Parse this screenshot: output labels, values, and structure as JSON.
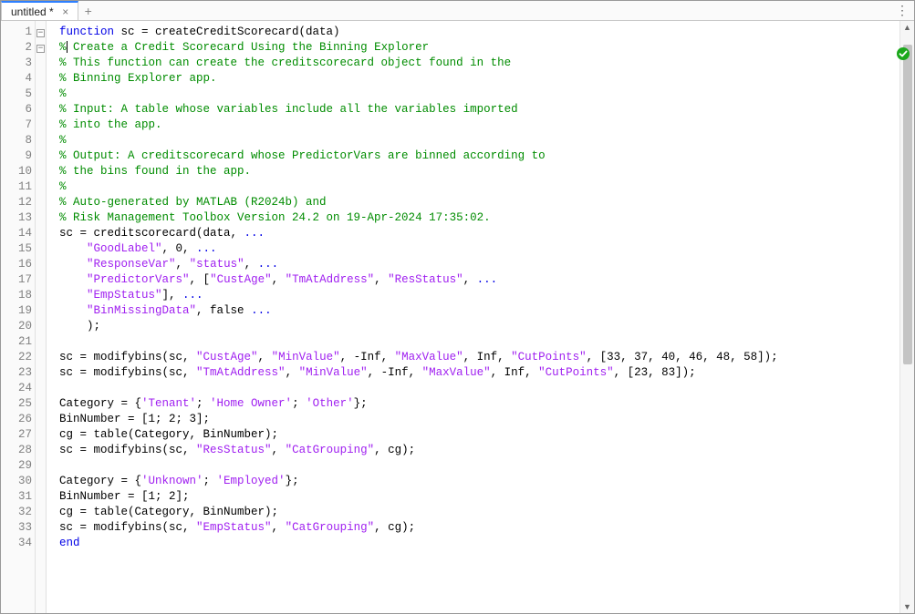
{
  "tab": {
    "title": "untitled *",
    "modified": true
  },
  "status": {
    "state": "ok"
  },
  "code": {
    "lines": [
      {
        "n": 1,
        "fold": "open",
        "tokens": [
          [
            "kw",
            "function"
          ],
          [
            "",
            " sc = createCreditScorecard(data)"
          ]
        ]
      },
      {
        "n": 2,
        "fold": "open",
        "caret": true,
        "tokens": [
          [
            "com",
            "%"
          ],
          [
            "cursor",
            ""
          ],
          [
            "com",
            " Create a Credit Scorecard Using the Binning Explorer"
          ]
        ]
      },
      {
        "n": 3,
        "tokens": [
          [
            "com",
            "% This function can create the creditscorecard object found in the"
          ]
        ]
      },
      {
        "n": 4,
        "tokens": [
          [
            "com",
            "% Binning Explorer app."
          ]
        ]
      },
      {
        "n": 5,
        "tokens": [
          [
            "com",
            "%"
          ]
        ]
      },
      {
        "n": 6,
        "tokens": [
          [
            "com",
            "% Input: A table whose variables include all the variables imported"
          ]
        ]
      },
      {
        "n": 7,
        "tokens": [
          [
            "com",
            "% into the app."
          ]
        ]
      },
      {
        "n": 8,
        "tokens": [
          [
            "com",
            "%"
          ]
        ]
      },
      {
        "n": 9,
        "tokens": [
          [
            "com",
            "% Output: A creditscorecard whose PredictorVars are binned according to"
          ]
        ]
      },
      {
        "n": 10,
        "tokens": [
          [
            "com",
            "% the bins found in the app."
          ]
        ]
      },
      {
        "n": 11,
        "tokens": [
          [
            "com",
            "%"
          ]
        ]
      },
      {
        "n": 12,
        "tokens": [
          [
            "com",
            "% Auto-generated by MATLAB (R2024b) and"
          ]
        ]
      },
      {
        "n": 13,
        "tokens": [
          [
            "com",
            "% Risk Management Toolbox Version 24.2 on 19-Apr-2024 17:35:02."
          ]
        ]
      },
      {
        "n": 14,
        "tokens": [
          [
            "",
            "sc = creditscorecard(data, "
          ],
          [
            "kw",
            "..."
          ]
        ]
      },
      {
        "n": 15,
        "tokens": [
          [
            "",
            "    "
          ],
          [
            "str",
            "\"GoodLabel\""
          ],
          [
            "",
            ", 0, "
          ],
          [
            "kw",
            "..."
          ]
        ]
      },
      {
        "n": 16,
        "tokens": [
          [
            "",
            "    "
          ],
          [
            "str",
            "\"ResponseVar\""
          ],
          [
            "",
            ", "
          ],
          [
            "str",
            "\"status\""
          ],
          [
            "",
            ", "
          ],
          [
            "kw",
            "..."
          ]
        ]
      },
      {
        "n": 17,
        "tokens": [
          [
            "",
            "    "
          ],
          [
            "str",
            "\"PredictorVars\""
          ],
          [
            "",
            ", ["
          ],
          [
            "str",
            "\"CustAge\""
          ],
          [
            "",
            ", "
          ],
          [
            "str",
            "\"TmAtAddress\""
          ],
          [
            "",
            ", "
          ],
          [
            "str",
            "\"ResStatus\""
          ],
          [
            "",
            ", "
          ],
          [
            "kw",
            "..."
          ]
        ]
      },
      {
        "n": 18,
        "tokens": [
          [
            "",
            "    "
          ],
          [
            "str",
            "\"EmpStatus\""
          ],
          [
            "",
            "], "
          ],
          [
            "kw",
            "..."
          ]
        ]
      },
      {
        "n": 19,
        "tokens": [
          [
            "",
            "    "
          ],
          [
            "str",
            "\"BinMissingData\""
          ],
          [
            "",
            ", false "
          ],
          [
            "kw",
            "..."
          ]
        ]
      },
      {
        "n": 20,
        "tokens": [
          [
            "",
            "    );"
          ]
        ]
      },
      {
        "n": 21,
        "tokens": [
          [
            "",
            ""
          ]
        ]
      },
      {
        "n": 22,
        "tokens": [
          [
            "",
            "sc = modifybins(sc, "
          ],
          [
            "str",
            "\"CustAge\""
          ],
          [
            "",
            ", "
          ],
          [
            "str",
            "\"MinValue\""
          ],
          [
            "",
            ", -Inf, "
          ],
          [
            "str",
            "\"MaxValue\""
          ],
          [
            "",
            ", Inf, "
          ],
          [
            "str",
            "\"CutPoints\""
          ],
          [
            "",
            ", [33, 37, 40, 46, 48, 58]);"
          ]
        ]
      },
      {
        "n": 23,
        "tokens": [
          [
            "",
            "sc = modifybins(sc, "
          ],
          [
            "str",
            "\"TmAtAddress\""
          ],
          [
            "",
            ", "
          ],
          [
            "str",
            "\"MinValue\""
          ],
          [
            "",
            ", -Inf, "
          ],
          [
            "str",
            "\"MaxValue\""
          ],
          [
            "",
            ", Inf, "
          ],
          [
            "str",
            "\"CutPoints\""
          ],
          [
            "",
            ", [23, 83]);"
          ]
        ]
      },
      {
        "n": 24,
        "tokens": [
          [
            "",
            ""
          ]
        ]
      },
      {
        "n": 25,
        "tokens": [
          [
            "",
            "Category = {"
          ],
          [
            "str",
            "'Tenant'"
          ],
          [
            "",
            "; "
          ],
          [
            "str",
            "'Home Owner'"
          ],
          [
            "",
            "; "
          ],
          [
            "str",
            "'Other'"
          ],
          [
            "",
            "};"
          ]
        ]
      },
      {
        "n": 26,
        "tokens": [
          [
            "",
            "BinNumber = [1; 2; 3];"
          ]
        ]
      },
      {
        "n": 27,
        "tokens": [
          [
            "",
            "cg = table(Category, BinNumber);"
          ]
        ]
      },
      {
        "n": 28,
        "tokens": [
          [
            "",
            "sc = modifybins(sc, "
          ],
          [
            "str",
            "\"ResStatus\""
          ],
          [
            "",
            ", "
          ],
          [
            "str",
            "\"CatGrouping\""
          ],
          [
            "",
            ", cg);"
          ]
        ]
      },
      {
        "n": 29,
        "tokens": [
          [
            "",
            ""
          ]
        ]
      },
      {
        "n": 30,
        "tokens": [
          [
            "",
            "Category = {"
          ],
          [
            "str",
            "'Unknown'"
          ],
          [
            "",
            "; "
          ],
          [
            "str",
            "'Employed'"
          ],
          [
            "",
            "};"
          ]
        ]
      },
      {
        "n": 31,
        "tokens": [
          [
            "",
            "BinNumber = [1; 2];"
          ]
        ]
      },
      {
        "n": 32,
        "tokens": [
          [
            "",
            "cg = table(Category, BinNumber);"
          ]
        ]
      },
      {
        "n": 33,
        "tokens": [
          [
            "",
            "sc = modifybins(sc, "
          ],
          [
            "str",
            "\"EmpStatus\""
          ],
          [
            "",
            ", "
          ],
          [
            "str",
            "\"CatGrouping\""
          ],
          [
            "",
            ", cg);"
          ]
        ]
      },
      {
        "n": 34,
        "tokens": [
          [
            "kw",
            "end"
          ]
        ]
      }
    ]
  },
  "scrollbar": {
    "thumb_top_pct": 4,
    "thumb_height_pct": 54
  }
}
